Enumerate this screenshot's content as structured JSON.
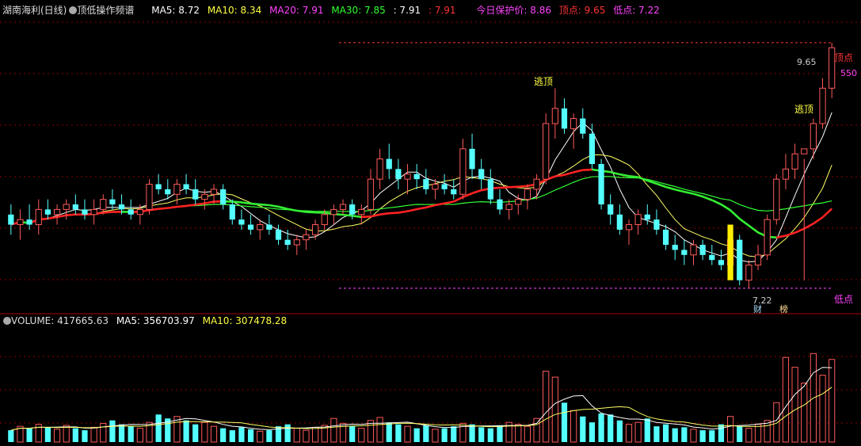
{
  "header": {
    "title": "湖南海利(日线)",
    "indicator_name": "顶低操作频谱",
    "ma5": "MA5: 8.72",
    "ma10": "MA10: 8.34",
    "ma20": "MA20: 7.91",
    "ma30": "MA30: 7.85",
    "v1": ": 7.91",
    "v2": ": 7.91",
    "protect": "今日保护价: 8.86",
    "top": "顶点: 9.65",
    "low": "低点: 7.22"
  },
  "volume_header": {
    "volume": "VOLUME: 417665.63",
    "ma5": "MA5: 356703.97",
    "ma10": "MA10: 307478.28"
  },
  "annotations": {
    "escape1": "逃顶",
    "escape2": "逃顶",
    "top_label": "顶点",
    "low_label": "低点",
    "top_value": "9.65",
    "low_value": "7.22",
    "right_value": "550",
    "marker_cai": "财",
    "marker_bang": "榜"
  },
  "colors": {
    "up": "#ff5a5a",
    "down": "#54ffff",
    "ma5": "#ffffff",
    "ma10": "#ffff66",
    "ma20": "#ff44ff",
    "ma30": "#33ff33",
    "grid": "#8b0000",
    "top_line": "#ff3333",
    "low_line": "#ff44ff"
  },
  "chart_data": [
    {
      "type": "candlestick",
      "title": "湖南海利(日线)",
      "ylim": [
        7.0,
        9.9
      ],
      "top_price": 9.65,
      "low_price": 7.22,
      "candles_ohlc": [
        [
          7.95,
          8.05,
          7.75,
          7.85
        ],
        [
          7.85,
          8.0,
          7.7,
          7.9
        ],
        [
          7.9,
          8.05,
          7.8,
          7.85
        ],
        [
          7.85,
          8.1,
          7.75,
          8.0
        ],
        [
          8.0,
          8.1,
          7.9,
          7.95
        ],
        [
          7.95,
          8.05,
          7.85,
          8.0
        ],
        [
          8.0,
          8.1,
          7.9,
          8.05
        ],
        [
          8.05,
          8.15,
          7.95,
          8.0
        ],
        [
          8.0,
          8.1,
          7.9,
          7.95
        ],
        [
          7.95,
          8.1,
          7.85,
          8.0
        ],
        [
          8.0,
          8.15,
          7.95,
          8.1
        ],
        [
          8.1,
          8.2,
          8.0,
          8.05
        ],
        [
          8.05,
          8.15,
          7.95,
          8.0
        ],
        [
          8.0,
          8.1,
          7.9,
          7.95
        ],
        [
          7.95,
          8.05,
          7.85,
          8.0
        ],
        [
          8.0,
          8.3,
          7.95,
          8.25
        ],
        [
          8.25,
          8.35,
          8.15,
          8.2
        ],
        [
          8.2,
          8.3,
          8.1,
          8.15
        ],
        [
          8.15,
          8.3,
          8.05,
          8.25
        ],
        [
          8.25,
          8.35,
          8.15,
          8.2
        ],
        [
          8.2,
          8.3,
          8.05,
          8.1
        ],
        [
          8.1,
          8.2,
          8.0,
          8.15
        ],
        [
          8.15,
          8.25,
          8.05,
          8.2
        ],
        [
          8.2,
          8.25,
          8.0,
          8.05
        ],
        [
          8.05,
          8.1,
          7.85,
          7.9
        ],
        [
          7.9,
          8.0,
          7.8,
          7.85
        ],
        [
          7.85,
          7.95,
          7.75,
          7.8
        ],
        [
          7.8,
          7.9,
          7.7,
          7.85
        ],
        [
          7.85,
          7.95,
          7.75,
          7.8
        ],
        [
          7.8,
          7.85,
          7.65,
          7.7
        ],
        [
          7.7,
          7.8,
          7.6,
          7.65
        ],
        [
          7.65,
          7.75,
          7.55,
          7.7
        ],
        [
          7.7,
          7.8,
          7.6,
          7.75
        ],
        [
          7.75,
          7.9,
          7.7,
          7.85
        ],
        [
          7.85,
          8.0,
          7.8,
          7.95
        ],
        [
          7.95,
          8.05,
          7.85,
          8.0
        ],
        [
          8.0,
          8.1,
          7.95,
          8.05
        ],
        [
          8.05,
          8.1,
          7.9,
          7.95
        ],
        [
          7.95,
          8.05,
          7.85,
          8.0
        ],
        [
          8.0,
          8.4,
          7.95,
          8.3
        ],
        [
          8.3,
          8.6,
          8.2,
          8.5
        ],
        [
          8.5,
          8.65,
          8.3,
          8.4
        ],
        [
          8.4,
          8.5,
          8.2,
          8.3
        ],
        [
          8.3,
          8.45,
          8.15,
          8.35
        ],
        [
          8.35,
          8.45,
          8.2,
          8.3
        ],
        [
          8.3,
          8.4,
          8.15,
          8.2
        ],
        [
          8.2,
          8.3,
          8.1,
          8.25
        ],
        [
          8.25,
          8.35,
          8.15,
          8.2
        ],
        [
          8.2,
          8.3,
          8.1,
          8.15
        ],
        [
          8.15,
          8.7,
          8.1,
          8.6
        ],
        [
          8.6,
          8.75,
          8.3,
          8.4
        ],
        [
          8.4,
          8.5,
          8.2,
          8.3
        ],
        [
          8.3,
          8.4,
          8.05,
          8.1
        ],
        [
          8.1,
          8.2,
          7.95,
          8.0
        ],
        [
          8.0,
          8.1,
          7.9,
          8.05
        ],
        [
          8.05,
          8.15,
          7.95,
          8.1
        ],
        [
          8.1,
          8.25,
          8.0,
          8.2
        ],
        [
          8.2,
          8.35,
          8.1,
          8.3
        ],
        [
          8.3,
          8.95,
          8.25,
          8.85
        ],
        [
          8.85,
          9.2,
          8.7,
          9.0
        ],
        [
          9.0,
          9.1,
          8.75,
          8.8
        ],
        [
          8.8,
          8.95,
          8.6,
          8.9
        ],
        [
          8.9,
          9.0,
          8.7,
          8.75
        ],
        [
          8.75,
          8.85,
          8.4,
          8.45
        ],
        [
          8.45,
          8.5,
          8.0,
          8.05
        ],
        [
          8.05,
          8.15,
          7.85,
          7.95
        ],
        [
          7.95,
          8.05,
          7.75,
          7.8
        ],
        [
          7.8,
          7.9,
          7.65,
          7.85
        ],
        [
          7.85,
          8.0,
          7.75,
          7.95
        ],
        [
          7.95,
          8.05,
          7.85,
          7.9
        ],
        [
          7.9,
          8.0,
          7.75,
          7.8
        ],
        [
          7.8,
          7.85,
          7.6,
          7.65
        ],
        [
          7.65,
          7.75,
          7.5,
          7.6
        ],
        [
          7.6,
          7.7,
          7.45,
          7.55
        ],
        [
          7.55,
          7.7,
          7.45,
          7.65
        ],
        [
          7.65,
          7.7,
          7.5,
          7.55
        ],
        [
          7.55,
          7.65,
          7.45,
          7.5
        ],
        [
          7.5,
          7.6,
          7.4,
          7.45
        ],
        [
          7.45,
          7.8,
          7.4,
          7.7
        ],
        [
          7.7,
          7.75,
          7.25,
          7.3
        ],
        [
          7.3,
          7.5,
          7.22,
          7.45
        ],
        [
          7.45,
          7.65,
          7.4,
          7.55
        ],
        [
          7.55,
          7.95,
          7.5,
          7.9
        ],
        [
          7.9,
          8.35,
          7.85,
          8.3
        ],
        [
          8.3,
          8.55,
          8.2,
          8.4
        ],
        [
          8.4,
          8.65,
          8.3,
          8.55
        ],
        [
          8.55,
          8.5,
          7.3,
          8.6
        ],
        [
          8.6,
          8.9,
          8.5,
          8.85
        ],
        [
          8.85,
          9.3,
          8.8,
          9.2
        ],
        [
          9.2,
          9.65,
          9.1,
          9.6
        ]
      ],
      "ma_lines": [
        {
          "name": "MA5",
          "color": "#ffffff"
        },
        {
          "name": "MA10",
          "color": "#ffff66"
        },
        {
          "name": "MA20",
          "color": "#ff44ff"
        },
        {
          "name": "MA30",
          "color": "#33ff33"
        }
      ]
    },
    {
      "type": "bar",
      "title": "VOLUME",
      "ylim": [
        0,
        580000
      ],
      "values": [
        60000,
        80000,
        70000,
        90000,
        75000,
        65000,
        85000,
        70000,
        60000,
        75000,
        95000,
        110000,
        90000,
        80000,
        70000,
        100000,
        140000,
        120000,
        130000,
        110000,
        90000,
        100000,
        80000,
        70000,
        60000,
        75000,
        65000,
        55000,
        60000,
        80000,
        90000,
        70000,
        60000,
        75000,
        85000,
        120000,
        95000,
        80000,
        70000,
        110000,
        125000,
        100000,
        90000,
        80000,
        70000,
        85000,
        65000,
        70000,
        80000,
        95000,
        90000,
        75000,
        70000,
        85000,
        100000,
        90000,
        80000,
        120000,
        360000,
        330000,
        200000,
        160000,
        130000,
        100000,
        145000,
        140000,
        110000,
        90000,
        100000,
        120000,
        80000,
        90000,
        70000,
        75000,
        65000,
        60000,
        60000,
        90000,
        130000,
        80000,
        70000,
        90000,
        110000,
        200000,
        430000,
        380000,
        300000,
        450000,
        340000,
        420000
      ]
    }
  ]
}
